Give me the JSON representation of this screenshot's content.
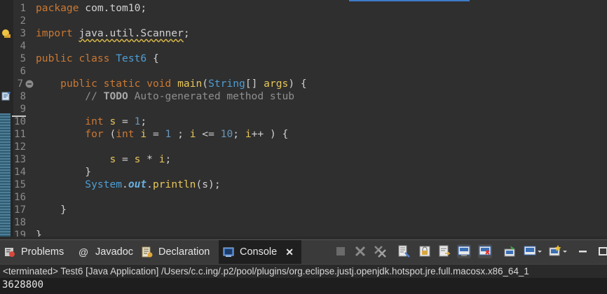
{
  "editor": {
    "lines": [
      {
        "n": "1"
      },
      {
        "n": "2"
      },
      {
        "n": "3"
      },
      {
        "n": "4"
      },
      {
        "n": "5"
      },
      {
        "n": "6"
      },
      {
        "n": "7"
      },
      {
        "n": "8"
      },
      {
        "n": "9"
      },
      {
        "n": "10"
      },
      {
        "n": "11"
      },
      {
        "n": "12"
      },
      {
        "n": "13"
      },
      {
        "n": "14"
      },
      {
        "n": "15"
      },
      {
        "n": "16"
      },
      {
        "n": "17"
      },
      {
        "n": "18"
      },
      {
        "n": "19"
      }
    ],
    "code": {
      "l1_kw": "package",
      "l1_rest": " com.tom10;",
      "l3_kw": "import",
      "l3_pkg": "java.util.Scanner",
      "l3_end": ";",
      "l5_kw1": "public",
      "l5_kw2": "class",
      "l5_name": "Test6",
      "l5_end": " {",
      "l7_kw1": "public",
      "l7_kw2": "static",
      "l7_kw3": "void",
      "l7_fn": "main",
      "l7_p1": "(",
      "l7_type": "String",
      "l7_p2": "[] ",
      "l7_arg": "args",
      "l7_end": ") {",
      "l8_cmt": "// ",
      "l8_todo": "TODO",
      "l8_rest": " Auto-generated method stub",
      "l10_kw": "int",
      "l10_var": "s",
      "l10_mid": " = ",
      "l10_num": "1",
      "l10_end": ";",
      "l11_kw": "for",
      "l11_p": " (",
      "l11_kw2": "int",
      "l11_i": "i",
      "l11_eq": " = ",
      "l11_n1": "1",
      "l11_s1": " ; ",
      "l11_i2": "i",
      "l11_le": " <= ",
      "l11_n2": "10",
      "l11_s2": "; ",
      "l11_i3": "i",
      "l11_inc": "++ ) {",
      "l13_s": "s",
      "l13_eq": " = ",
      "l13_s2": "s",
      "l13_mul": " * ",
      "l13_i": "i",
      "l13_end": ";",
      "l14": "}",
      "l15_cls": "System",
      "l15_dot": ".",
      "l15_out": "out",
      "l15_dot2": ".",
      "l15_fn": "println",
      "l15_end": "(s);",
      "l17": "}",
      "l19": "}"
    }
  },
  "tabs": {
    "problems": "Problems",
    "javadoc": "Javadoc",
    "declaration": "Declaration",
    "console": "Console",
    "close": "✕"
  },
  "console": {
    "status": "<terminated> Test6 [Java Application] /Users/c.c.ing/.p2/pool/plugins/org.eclipse.justj.openjdk.hotspot.jre.full.macosx.x86_64_1",
    "output": "3628800"
  }
}
